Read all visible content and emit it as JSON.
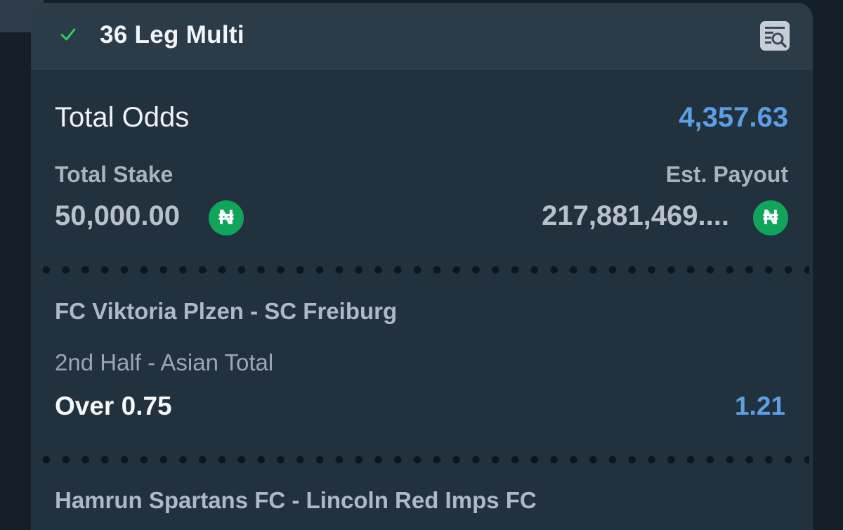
{
  "header": {
    "title": "36 Leg Multi",
    "status_icon": "check-icon",
    "action_icon": "search-document-icon"
  },
  "summary": {
    "total_odds_label": "Total Odds",
    "total_odds_value": "4,357.63",
    "total_stake_label": "Total Stake",
    "total_stake_value": "50,000.00",
    "est_payout_label": "Est. Payout",
    "est_payout_value": "217,881,469....",
    "currency_symbol": "₦"
  },
  "legs": [
    {
      "event": "FC Viktoria Plzen - SC Freiburg",
      "market": "2nd Half - Asian Total",
      "selection": "Over 0.75",
      "odds": "1.21"
    },
    {
      "event": "Hamrun Spartans FC - Lincoln Red Imps FC"
    }
  ],
  "colors": {
    "accent_blue": "#5b9fe6",
    "check_green": "#2fcf56",
    "currency_green": "#10a55b",
    "card_bg": "#22313e",
    "header_bg": "#2b3b48"
  }
}
